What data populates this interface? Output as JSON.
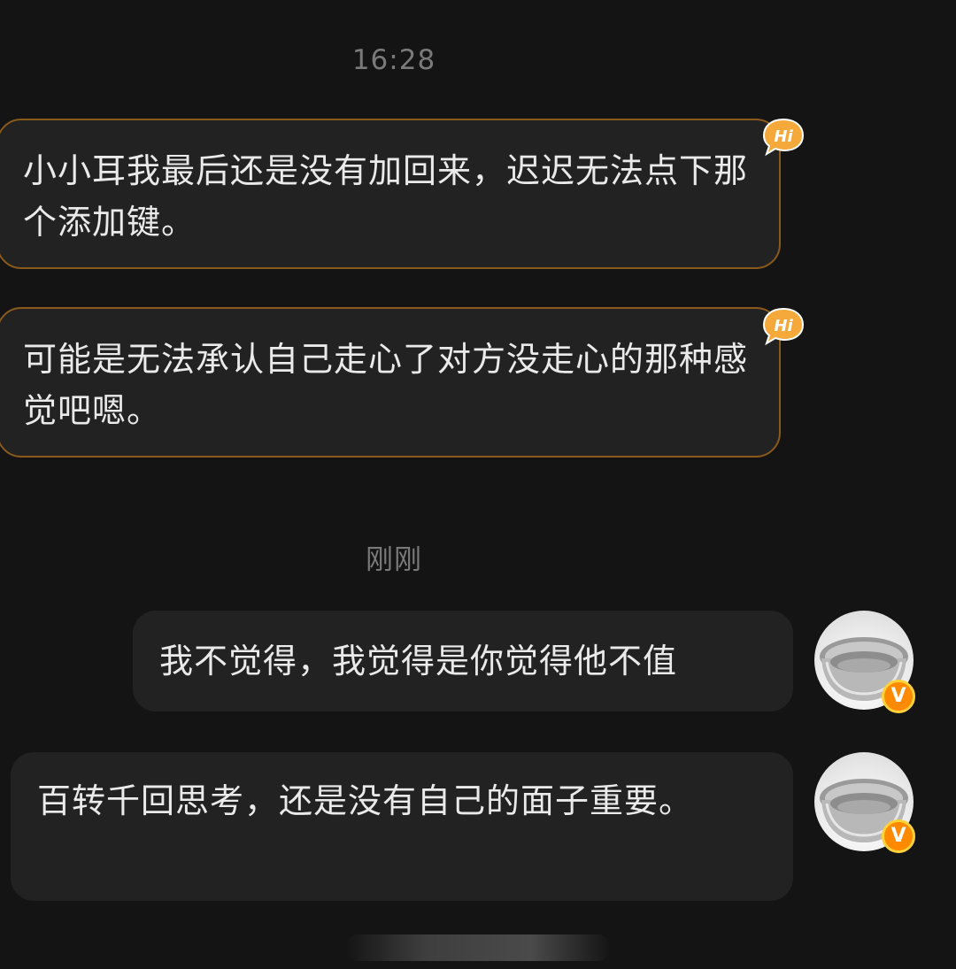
{
  "chat": {
    "time_1": "16:28",
    "time_2": "刚刚",
    "messages": [
      {
        "side": "incoming",
        "text": "小小耳我最后还是没有加回来，迟迟无法点下那个添加键。",
        "badge": "Hi"
      },
      {
        "side": "incoming",
        "text": "可能是无法承认自己走心了对方没走心的那种感觉吧嗯。",
        "badge": "Hi"
      },
      {
        "side": "outgoing",
        "text": "我不觉得，我觉得是你觉得他不值",
        "vip": "V",
        "avatar": "stainless-bowl-avatar"
      },
      {
        "side": "outgoing",
        "text": "百转千回思考，还是没有自己的面子重要。",
        "vip": "V",
        "avatar": "stainless-bowl-avatar"
      }
    ]
  },
  "colors": {
    "background": "#141414",
    "bubble": "#222222",
    "incoming_border": "#8a5a1c",
    "hi_badge": "#f4a93a",
    "vip_badge": "#ff8a00",
    "timestamp": "#7a7a7a"
  }
}
